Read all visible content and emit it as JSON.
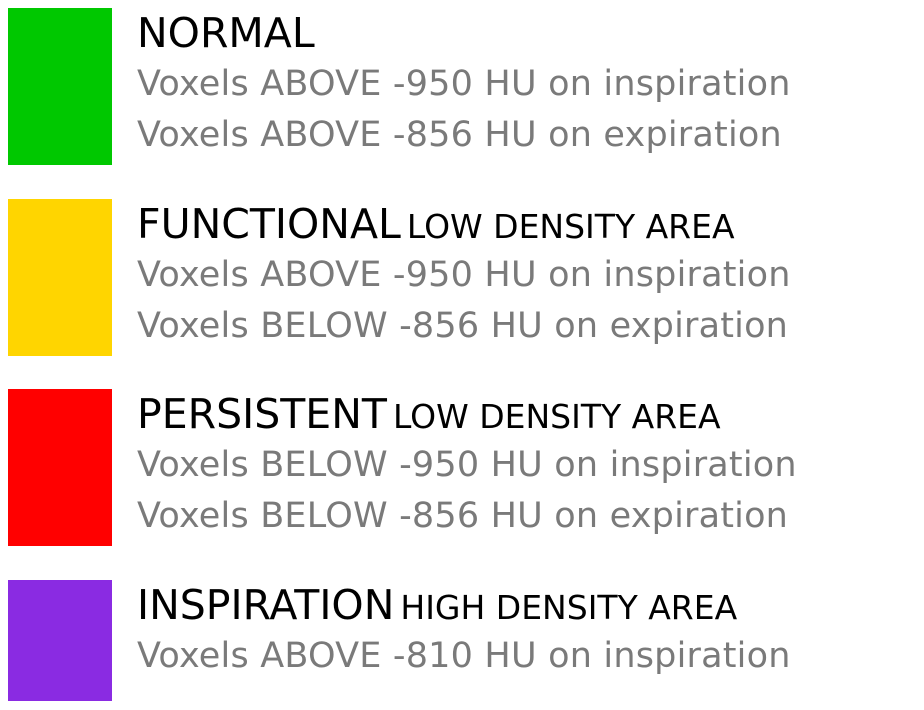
{
  "legend": [
    {
      "color": "#00c800",
      "title": "NORMAL",
      "subtitle": "",
      "lines": [
        "Voxels ABOVE -950 HU on inspiration",
        "Voxels ABOVE -856 HU on expiration"
      ]
    },
    {
      "color": "#ffd500",
      "title": "FUNCTIONAL",
      "subtitle": "LOW DENSITY AREA",
      "lines": [
        "Voxels ABOVE -950 HU on inspiration",
        "Voxels BELOW -856 HU on expiration"
      ]
    },
    {
      "color": "#ff0000",
      "title": "PERSISTENT",
      "subtitle": "LOW DENSITY AREA",
      "lines": [
        "Voxels BELOW -950 HU on inspiration",
        "Voxels BELOW -856 HU on expiration"
      ]
    },
    {
      "color": "#8a2be2",
      "title": "INSPIRATION",
      "subtitle": "HIGH DENSITY AREA",
      "lines": [
        "Voxels ABOVE -810 HU on inspiration"
      ]
    }
  ]
}
